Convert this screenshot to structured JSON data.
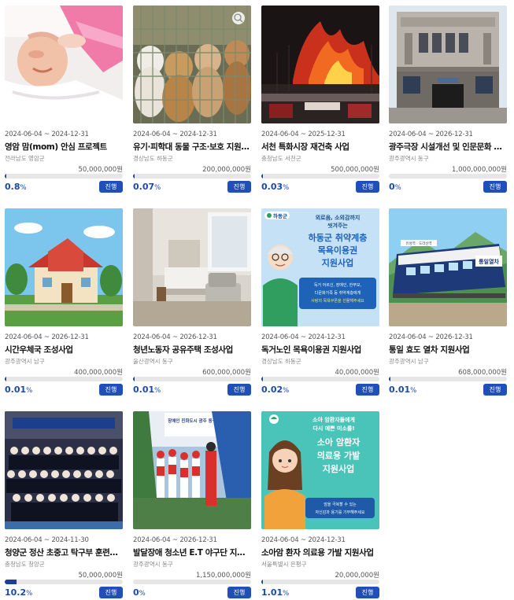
{
  "status_label": "진행",
  "percent_sign": "%",
  "cards": [
    {
      "period": "2024-06-04 ~ 2024-12-31",
      "title": "영암 맘(mom) 안심 프로젝트",
      "region": "전라남도 영암군",
      "goal": "50,000,000원",
      "rate": "0.8",
      "progress": 0.008
    },
    {
      "period": "2024-06-04 ~ 2024-12-31",
      "title": "유기·피학대 동물 구조·보호 지원사업",
      "region": "경상남도 하동군",
      "goal": "200,000,000원",
      "rate": "0.07",
      "progress": 0.0007
    },
    {
      "period": "2024-06-04 ~ 2025-12-31",
      "title": "서천 특화시장 재건축 사업",
      "region": "충청남도 서천군",
      "goal": "500,000,000원",
      "rate": "0.03",
      "progress": 0.0003
    },
    {
      "period": "2024-06-04 ~ 2026-12-31",
      "title": "광주극장 시설개선 및 인문문화 프로그램",
      "region": "광주광역시 동구",
      "goal": "1,000,000,000원",
      "rate": "0",
      "progress": 0
    },
    {
      "period": "2024-06-04 ~ 2026-12-31",
      "title": "시간우체국 조성사업",
      "region": "광주광역시 남구",
      "goal": "400,000,000원",
      "rate": "0.01",
      "progress": 0.0001
    },
    {
      "period": "2024-06-04 ~ 2026-12-31",
      "title": "청년노동자 공유주택 조성사업",
      "region": "울산광역시 동구",
      "goal": "600,000,000원",
      "rate": "0.01",
      "progress": 0.0001
    },
    {
      "period": "2024-06-04 ~ 2024-12-31",
      "title": "독거노인 목욕이용권 지원사업",
      "region": "경상남도 하동군",
      "goal": "40,000,000원",
      "rate": "0.02",
      "progress": 0.0002
    },
    {
      "period": "2024-06-04 ~ 2026-12-31",
      "title": "통일 효도 열차 지원사업",
      "region": "광주광역시 남구",
      "goal": "608,000,000원",
      "rate": "0.01",
      "progress": 0.0001
    },
    {
      "period": "2024-06-04 ~ 2024-11-30",
      "title": "청양군 정산 초중고 탁구부 훈련용품 지원",
      "region": "충청남도 청양군",
      "goal": "50,000,000원",
      "rate": "10.2",
      "progress": 0.102
    },
    {
      "period": "2024-06-04 ~ 2026-12-31",
      "title": "발달장애 청소년 E.T 야구단 지원사업",
      "region": "광주광역시 동구",
      "goal": "1,150,000,000원",
      "rate": "0",
      "progress": 0
    },
    {
      "period": "2024-06-04 ~ 2024-12-31",
      "title": "소아암 환자 의료용 가발 지원사업",
      "region": "서울특별시 은평구",
      "goal": "20,000,000원",
      "rate": "1.01",
      "progress": 0.0101
    }
  ],
  "poster_hadong": {
    "logo": "하동군",
    "line1": "외로움, 소외감까지",
    "line2": "씻겨주는",
    "line3": "하동군 취약계층",
    "line4": "목욕이용권",
    "line5": "지원사업",
    "note1": "독거 어르신, 장애인, 한부모,",
    "note2": "다문화가족 등 취약계층에게",
    "note3": "사랑의 목욕쿠폰을 선물해주세요"
  },
  "poster_cancer": {
    "line1": "소아 암환자들에게",
    "line2": "다시 예쁜 미소를!",
    "line3": "소아 암환자",
    "line4": "의료용 가발",
    "line5": "지원사업",
    "note1": "암을 극복할 수 있는",
    "note2": "자신감과 용기를 기부해주세요"
  },
  "train_sign": "통일열차",
  "train_small": "유성역 · 도라산역",
  "banner_text": "장애인 친화도시 광주 동구"
}
